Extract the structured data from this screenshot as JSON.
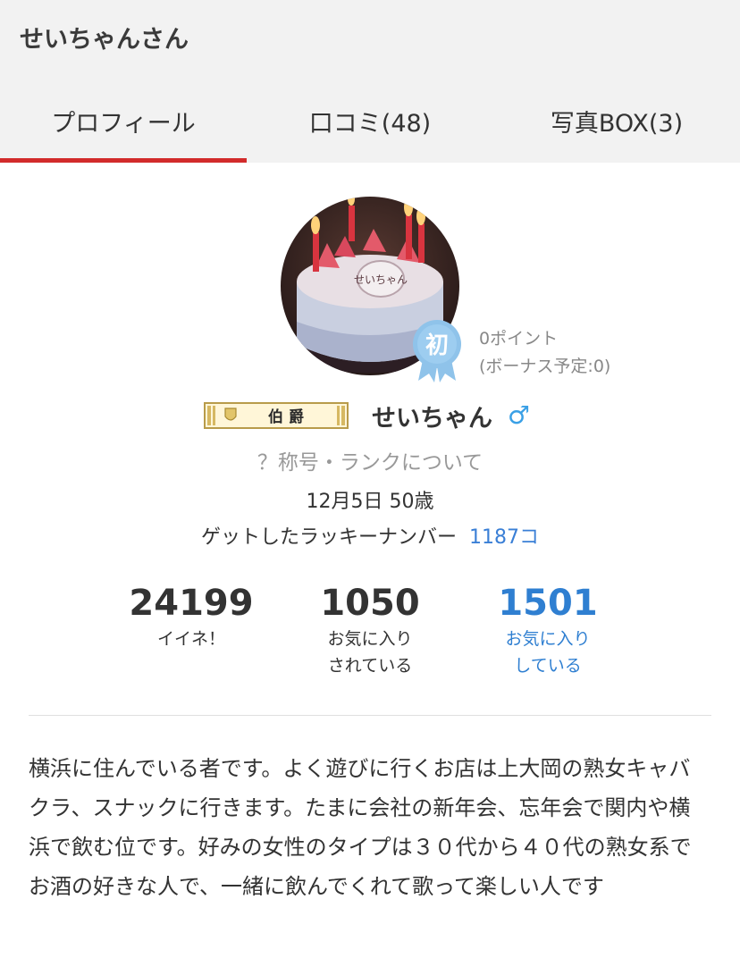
{
  "header": {
    "title": "せいちゃんさん"
  },
  "tabs": [
    {
      "label": "プロフィール",
      "active": true
    },
    {
      "label": "口コミ(48)",
      "active": false
    },
    {
      "label": "写真BOX(3)",
      "active": false
    }
  ],
  "profile": {
    "badge_char": "初",
    "points": "0ポイント",
    "bonus": "(ボーナス予定:0)",
    "rank_plate": "伯 爵",
    "username": "せいちゃん",
    "gender_symbol": "♂",
    "rank_link": "？称号・ランクについて",
    "birth_age": "12月5日 50歳",
    "lucky_label": "ゲットしたラッキーナンバー",
    "lucky_value": "1187コ"
  },
  "stats": [
    {
      "num": "24199",
      "line1": "イイネ！",
      "line2": ""
    },
    {
      "num": "1050",
      "line1": "お気に入り",
      "line2": "されている"
    },
    {
      "num": "1501",
      "line1": "お気に入り",
      "line2": "している"
    }
  ],
  "bio": "横浜に住んでいる者です。よく遊びに行くお店は上大岡の熟女キャバクラ、スナックに行きます。たまに会社の新年会、忘年会で関内や横浜で飲む位です。好みの女性のタイプは３０代から４０代の熟女系でお酒の好きな人で、一緒に飲んでくれて歌って楽しい人です",
  "colors": {
    "accent": "#d22b2b",
    "link": "#2f7fd1",
    "badge": "#8fc3ea",
    "gender": "#3aa0e6"
  }
}
